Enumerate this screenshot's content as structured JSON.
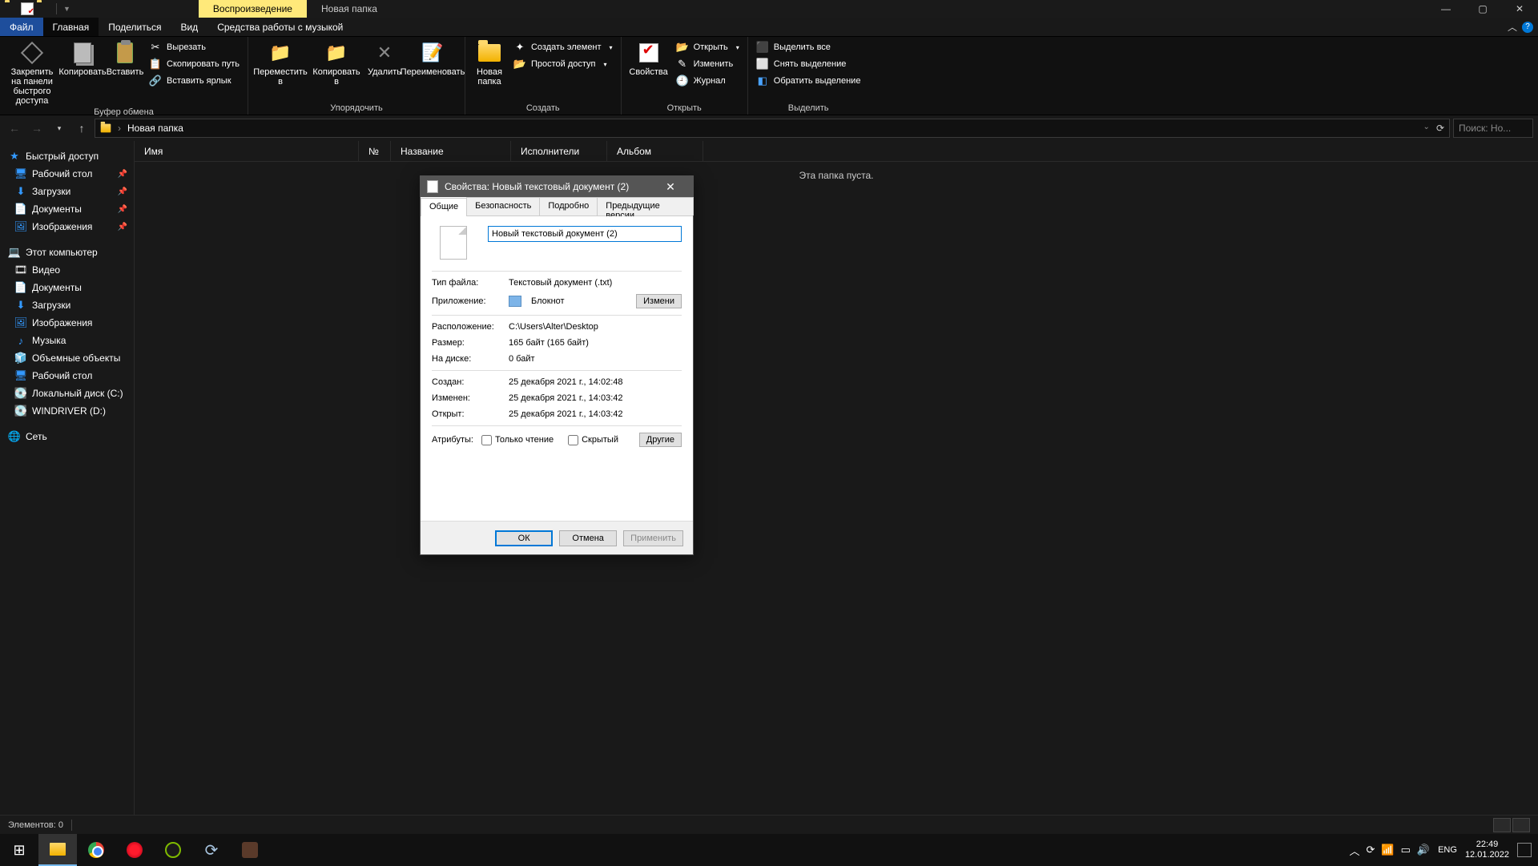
{
  "titlebar": {
    "playback_tab": "Воспроизведение",
    "window_title": "Новая папка"
  },
  "ribbon_tabs": {
    "file": "Файл",
    "home": "Главная",
    "share": "Поделиться",
    "view": "Вид",
    "music_tools": "Средства работы с музыкой"
  },
  "ribbon": {
    "pin": "Закрепить на панели быстрого доступа",
    "copy": "Копировать",
    "paste": "Вставить",
    "cut": "Вырезать",
    "copy_path": "Скопировать путь",
    "paste_shortcut": "Вставить ярлык",
    "clipboard_group": "Буфер обмена",
    "move_to": "Переместить в",
    "copy_to": "Копировать в",
    "delete": "Удалить",
    "rename": "Переименовать",
    "organize_group": "Упорядочить",
    "new_folder": "Новая папка",
    "new_item": "Создать элемент",
    "easy_access": "Простой доступ",
    "create_group": "Создать",
    "properties": "Свойства",
    "open": "Открыть",
    "edit": "Изменить",
    "history": "Журнал",
    "open_group": "Открыть",
    "select_all": "Выделить все",
    "select_none": "Снять выделение",
    "invert_selection": "Обратить выделение",
    "select_group": "Выделить"
  },
  "address": {
    "crumb": "Новая папка",
    "search_placeholder": "Поиск: Но..."
  },
  "sidebar": {
    "quick_access": "Быстрый доступ",
    "desktop": "Рабочий стол",
    "downloads": "Загрузки",
    "documents": "Документы",
    "pictures": "Изображения",
    "this_pc": "Этот компьютер",
    "videos": "Видео",
    "documents2": "Документы",
    "downloads2": "Загрузки",
    "pictures2": "Изображения",
    "music": "Музыка",
    "objects3d": "Объемные объекты",
    "desktop2": "Рабочий стол",
    "local_disk": "Локальный диск (C:)",
    "windriver": "WINDRIVER (D:)",
    "network": "Сеть"
  },
  "columns": {
    "name": "Имя",
    "number": "№",
    "title": "Название",
    "artists": "Исполнители",
    "album": "Альбом"
  },
  "content": {
    "empty": "Эта папка пуста."
  },
  "statusbar": {
    "items": "Элементов: 0"
  },
  "dialog": {
    "title": "Свойства: Новый текстовый документ (2)",
    "tabs": {
      "general": "Общие",
      "security": "Безопасность",
      "details": "Подробно",
      "previous": "Предыдущие версии"
    },
    "filename": "Новый текстовый документ (2)",
    "type_label": "Тип файла:",
    "type_value": "Текстовый документ (.txt)",
    "app_label": "Приложение:",
    "app_value": "Блокнот",
    "change_btn": "Измени",
    "location_label": "Расположение:",
    "location_value": "C:\\Users\\Alter\\Desktop",
    "size_label": "Размер:",
    "size_value": "165 байт (165 байт)",
    "ondisk_label": "На диске:",
    "ondisk_value": "0 байт",
    "created_label": "Создан:",
    "created_value": "25 декабря 2021 г., 14:02:48",
    "modified_label": "Изменен:",
    "modified_value": "25 декабря 2021 г., 14:03:42",
    "accessed_label": "Открыт:",
    "accessed_value": "25 декабря 2021 г., 14:03:42",
    "attributes_label": "Атрибуты:",
    "readonly": "Только чтение",
    "hidden": "Скрытый",
    "other_btn": "Другие",
    "ok": "ОК",
    "cancel": "Отмена",
    "apply": "Применить"
  },
  "taskbar": {
    "lang": "ENG",
    "time": "22:49",
    "date": "12.01.2022"
  }
}
